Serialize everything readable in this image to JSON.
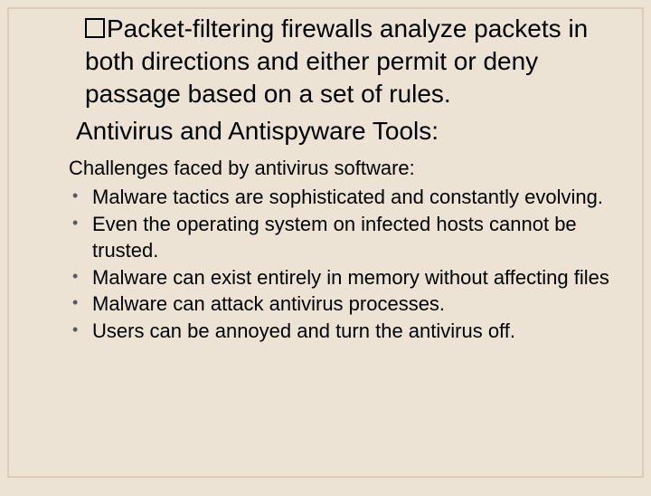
{
  "lead_text": "Packet-filtering  firewalls  analyze  packets  in  both directions and either permit or deny passage based on a set of rules.",
  "heading": "Antivirus and Antispyware Tools:",
  "subheading": "Challenges faced by antivirus software:",
  "bullets": [
    "Malware tactics are sophisticated and constantly  evolving.",
    "Even the operating system on infected hosts cannot  be trusted.",
    "Malware can exist entirely in memory without affecting files",
    "Malware can attack antivirus processes.",
    "Users can be annoyed and turn the antivirus off."
  ]
}
